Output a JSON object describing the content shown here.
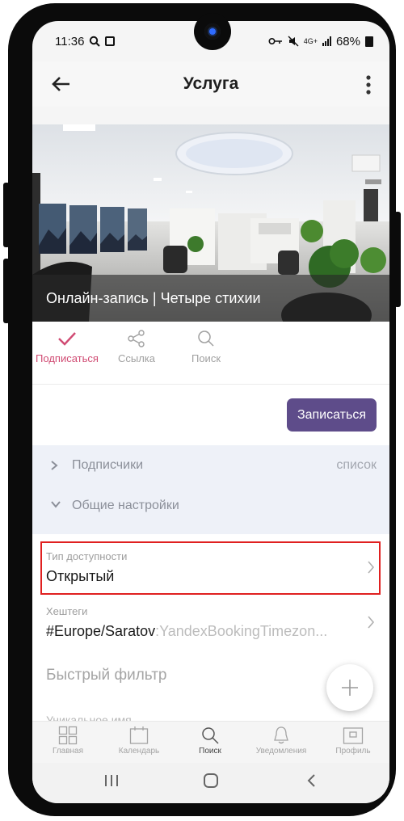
{
  "status_bar": {
    "time": "11:36",
    "battery": "68%",
    "network": "4G+"
  },
  "app_bar": {
    "title": "Услуга"
  },
  "hero": {
    "caption": "Онлайн-запись | Четыре стихии"
  },
  "actions": [
    {
      "label": "Подписаться",
      "icon": "check-icon",
      "active": true
    },
    {
      "label": "Ссылка",
      "icon": "share-icon",
      "active": false
    },
    {
      "label": "Поиск",
      "icon": "search-icon",
      "active": false
    }
  ],
  "cta": {
    "label": "Записаться"
  },
  "sections": {
    "subscribers": {
      "label": "Подписчики",
      "right": "список"
    },
    "general": {
      "label": "Общие настройки"
    }
  },
  "fields": {
    "availability": {
      "label": "Тип доступности",
      "value": "Открытый"
    },
    "hashtags": {
      "label": "Хештеги",
      "value_main": "#Europe/Saratov",
      "value_rest": ":YandexBookingTimezon..."
    },
    "quick_filter": {
      "label": "Быстрый фильтр"
    },
    "unique_name": {
      "label": "Уникальное имя"
    }
  },
  "bottom_nav": [
    {
      "label": "Главная",
      "icon": "home-grid-icon",
      "active": false
    },
    {
      "label": "Календарь",
      "icon": "calendar-icon",
      "active": false
    },
    {
      "label": "Поиск",
      "icon": "search-icon",
      "active": true
    },
    {
      "label": "Уведомления",
      "icon": "bell-icon",
      "active": false
    },
    {
      "label": "Профиль",
      "icon": "profile-icon",
      "active": false
    }
  ],
  "colors": {
    "accent": "#d04b73",
    "cta": "#5e4c8a",
    "section_bg": "#eef1f8",
    "highlight": "#e02020"
  }
}
